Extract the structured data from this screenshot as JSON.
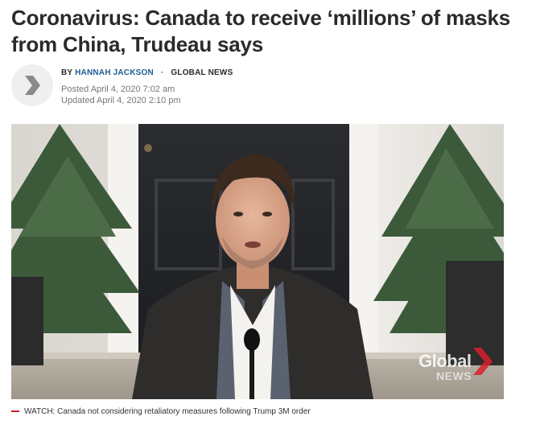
{
  "article": {
    "headline": "Coronavirus: Canada to receive ‘millions’ of masks from China, Trudeau says",
    "byline_prefix": "BY",
    "author": "HANNAH JACKSON",
    "separator": "·",
    "outlet": "GLOBAL NEWS",
    "posted": "Posted April 4, 2020 7:02 am",
    "updated": "Updated April 4, 2020 2:10 pm"
  },
  "video": {
    "watermark_brand": "Global",
    "watermark_sub": "NEWS",
    "caption_prefix": "WATCH:",
    "caption_text": "Canada not considering retaliatory measures following Trump 3M order"
  },
  "icons": {
    "logo": "global-news-chevron-icon"
  },
  "colors": {
    "author_link": "#1f5a93",
    "accent": "#c81e2b"
  }
}
